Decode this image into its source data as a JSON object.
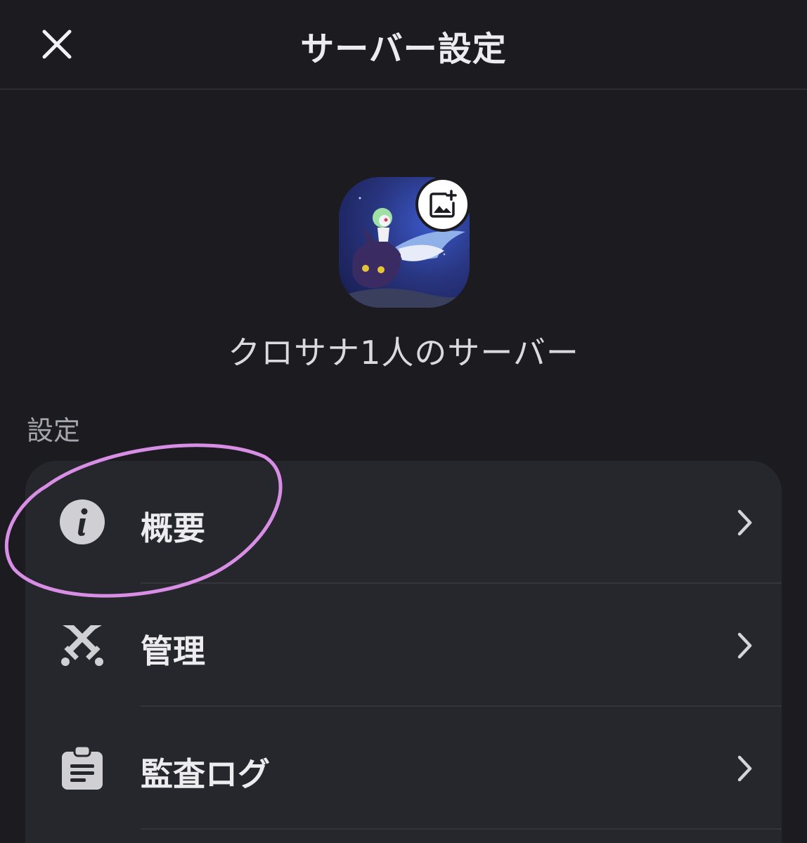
{
  "header": {
    "title": "サーバー設定",
    "close_icon": "close-icon"
  },
  "server": {
    "name": "クロサナ1人のサーバー",
    "icon_upload_icon": "image-add-icon"
  },
  "settings": {
    "section_label": "設定",
    "items": [
      {
        "label": "概要",
        "icon": "info-icon"
      },
      {
        "label": "管理",
        "icon": "moderation-swords-icon"
      },
      {
        "label": "監査ログ",
        "icon": "clipboard-icon"
      }
    ]
  },
  "annotation": {
    "color": "#d98ee6",
    "target": "概要"
  },
  "colors": {
    "background": "#1b1b20",
    "card": "#26262d",
    "icon_gray": "#cfcfd4"
  }
}
